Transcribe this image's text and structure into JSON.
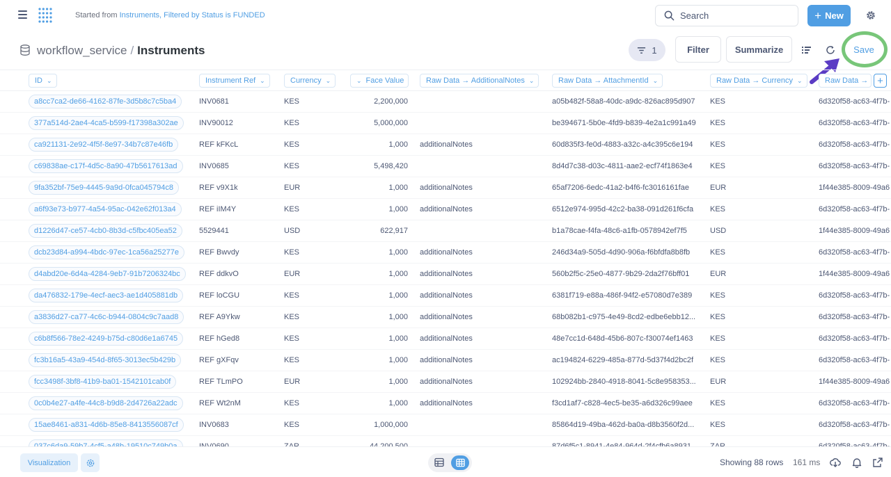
{
  "app": {
    "started_prefix": "Started from ",
    "started_link": "Instruments, Filtered by Status is FUNDED",
    "search_label": "Search",
    "new_label": "New"
  },
  "header": {
    "database": "workflow_service",
    "separator": "/",
    "table": "Instruments",
    "filter_count": "1",
    "filter_label": "Filter",
    "summarize_label": "Summarize",
    "save_label": "Save"
  },
  "colors": {
    "brand": "#509ee3",
    "annotation_circle": "#78c679",
    "annotation_arrow": "#5b3cc4"
  },
  "columns": [
    "ID",
    "Instrument Ref",
    "Currency",
    "Face Value",
    "Raw Data → AdditionalNotes",
    "Raw Data → AttachmentId",
    "Raw Data → Currency",
    "Raw Data →"
  ],
  "rows": [
    {
      "id": "a8cc7ca2-de66-4162-87fe-3d5b8c7c5ba4",
      "ref": "INV0681",
      "currency": "KES",
      "face": "2,200,000",
      "notes": "",
      "attachment": "a05b482f-58a8-40dc-a9dc-826ac895d907",
      "raw_currency": "KES",
      "raw": "6d320f58-ac63-4f7b-"
    },
    {
      "id": "377a514d-2ae4-4ca5-b599-f17398a302ae",
      "ref": "INV90012",
      "currency": "KES",
      "face": "5,000,000",
      "notes": "",
      "attachment": "be394671-5b0e-4fd9-b839-4e2a1c991a49",
      "raw_currency": "KES",
      "raw": "6d320f58-ac63-4f7b-"
    },
    {
      "id": "ca921131-2e92-4f5f-8e97-34b7c87e46fb",
      "ref": "REF kFKcL",
      "currency": "KES",
      "face": "1,000",
      "notes": "additionalNotes",
      "attachment": "60d835f3-fe0d-4883-a32c-a4c395c6e194",
      "raw_currency": "KES",
      "raw": "6d320f58-ac63-4f7b-"
    },
    {
      "id": "c69838ae-c17f-4d5c-8a90-47b5617613ad",
      "ref": "INV0685",
      "currency": "KES",
      "face": "5,498,420",
      "notes": "",
      "attachment": "8d4d7c38-d03c-4811-aae2-ecf74f1863e4",
      "raw_currency": "KES",
      "raw": "6d320f58-ac63-4f7b-"
    },
    {
      "id": "9fa352bf-75e9-4445-9a9d-0fca045794c8",
      "ref": "REF v9X1k",
      "currency": "EUR",
      "face": "1,000",
      "notes": "additionalNotes",
      "attachment": "65af7206-6edc-41a2-b4f6-fc3016161fae",
      "raw_currency": "EUR",
      "raw": "1f44e385-8009-49a6"
    },
    {
      "id": "a6f93e73-b977-4a54-95ac-042e62f013a4",
      "ref": "REF iIM4Y",
      "currency": "KES",
      "face": "1,000",
      "notes": "additionalNotes",
      "attachment": "6512e974-995d-42c2-ba38-091d261f6cfa",
      "raw_currency": "KES",
      "raw": "6d320f58-ac63-4f7b-"
    },
    {
      "id": "d1226d47-ce57-4cb0-8b3d-c5fbc405ea52",
      "ref": "5529441",
      "currency": "USD",
      "face": "622,917",
      "notes": "",
      "attachment": "b1a78cae-f4fa-48c6-a1fb-0578942ef7f5",
      "raw_currency": "USD",
      "raw": "1f44e385-8009-49a6"
    },
    {
      "id": "dcb23d84-a994-4bdc-97ec-1ca56a25277e",
      "ref": "REF Bwvdy",
      "currency": "KES",
      "face": "1,000",
      "notes": "additionalNotes",
      "attachment": "246d34a9-505d-4d90-906a-f6bfdfa8b8fb",
      "raw_currency": "KES",
      "raw": "6d320f58-ac63-4f7b-"
    },
    {
      "id": "d4abd20e-6d4a-4284-9eb7-91b7206324bc",
      "ref": "REF ddkvO",
      "currency": "EUR",
      "face": "1,000",
      "notes": "additionalNotes",
      "attachment": "560b2f5c-25e0-4877-9b29-2da2f76bff01",
      "raw_currency": "EUR",
      "raw": "1f44e385-8009-49a6"
    },
    {
      "id": "da476832-179e-4ecf-aec3-ae1d405881db",
      "ref": "REF loCGU",
      "currency": "KES",
      "face": "1,000",
      "notes": "additionalNotes",
      "attachment": "6381f719-e88a-486f-94f2-e57080d7e389",
      "raw_currency": "KES",
      "raw": "6d320f58-ac63-4f7b-"
    },
    {
      "id": "a3836d27-ca77-4c6c-b944-0804c9c7aad8",
      "ref": "REF A9Ykw",
      "currency": "KES",
      "face": "1,000",
      "notes": "additionalNotes",
      "attachment": "68b082b1-c975-4e49-8cd2-edbe6ebb12...",
      "raw_currency": "KES",
      "raw": "6d320f58-ac63-4f7b-"
    },
    {
      "id": "c6b8f566-78e2-4249-b75d-c80d6e1a6745",
      "ref": "REF hGed8",
      "currency": "KES",
      "face": "1,000",
      "notes": "additionalNotes",
      "attachment": "48e7cc1d-648d-45b6-807c-f30074ef1463",
      "raw_currency": "KES",
      "raw": "6d320f58-ac63-4f7b-"
    },
    {
      "id": "fc3b16a5-43a9-454d-8f65-3013ec5b429b",
      "ref": "REF gXFqv",
      "currency": "KES",
      "face": "1,000",
      "notes": "additionalNotes",
      "attachment": "ac194824-6229-485a-877d-5d37f4d2bc2f",
      "raw_currency": "KES",
      "raw": "6d320f58-ac63-4f7b-"
    },
    {
      "id": "fcc3498f-3bf8-41b9-ba01-1542101cab0f",
      "ref": "REF TLmPO",
      "currency": "EUR",
      "face": "1,000",
      "notes": "additionalNotes",
      "attachment": "102924bb-2840-4918-8041-5c8e958353...",
      "raw_currency": "EUR",
      "raw": "1f44e385-8009-49a6"
    },
    {
      "id": "0c0b4e27-a4fe-44c8-b9d8-2d4726a22adc",
      "ref": "REF Wt2nM",
      "currency": "KES",
      "face": "1,000",
      "notes": "additionalNotes",
      "attachment": "f3cd1af7-c828-4ec5-be35-a6d326c99aee",
      "raw_currency": "KES",
      "raw": "6d320f58-ac63-4f7b-"
    },
    {
      "id": "15ae8461-a831-4d6b-85e8-8413556087cf",
      "ref": "INV0683",
      "currency": "KES",
      "face": "1,000,000",
      "notes": "",
      "attachment": "85864d19-49ba-462d-ba0a-d8b3560f2d...",
      "raw_currency": "KES",
      "raw": "6d320f58-ac63-4f7b-"
    },
    {
      "id": "037c6da9-59b7-4cf5-a48b-19510c749b0a",
      "ref": "INV0690",
      "currency": "ZAR",
      "face": "44,200,500",
      "notes": "",
      "attachment": "87d6f5c1-8941-4e84-964d-2f4cfb6a8931",
      "raw_currency": "ZAR",
      "raw": "6d320f58-ac63-4f7b-"
    }
  ],
  "footer": {
    "visualization_label": "Visualization",
    "row_count": "Showing 88 rows",
    "timing": "161 ms"
  },
  "icons": [
    "menu-icon",
    "logo-icon",
    "search-icon",
    "plus-icon",
    "gear-icon",
    "database-icon",
    "filter-icon",
    "list-icon",
    "refresh-icon",
    "chevron-down-icon",
    "download-icon",
    "bell-icon",
    "share-icon",
    "table-icon",
    "grid-icon"
  ]
}
